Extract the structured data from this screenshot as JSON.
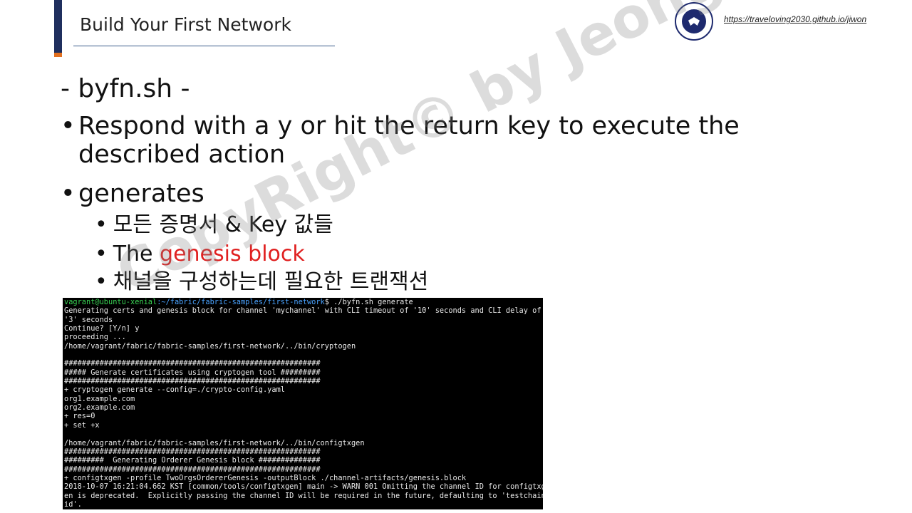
{
  "header": {
    "title": "Build Your First Network",
    "url": "https://traveloving2030.github.io/jiwon"
  },
  "content": {
    "heading": "- byfn.sh -",
    "bullet_1": "Respond with a y or hit the return key to execute the described action",
    "bullet_2": "generates",
    "sub_1": "모든 증명서 & Key 값들",
    "sub_2_prefix": "The ",
    "sub_2_highlight": "genesis block",
    "sub_3": "채널을 구성하는데 필요한 트랜잭션",
    "bullet_symbol": "•"
  },
  "terminal": {
    "prompt_user": "vagrant@ubuntu-xenial",
    "prompt_path": ":~/fabric/fabric-samples/first-network",
    "prompt_cmd": "$ ./byfn.sh generate",
    "lines": [
      "Generating certs and genesis block for channel 'mychannel' with CLI timeout of '10' seconds and CLI delay of",
      "'3' seconds",
      "Continue? [Y/n] y",
      "proceeding ...",
      "/home/vagrant/fabric/fabric-samples/first-network/../bin/cryptogen",
      "",
      "##########################################################",
      "##### Generate certificates using cryptogen tool #########",
      "##########################################################",
      "+ cryptogen generate --config=./crypto-config.yaml",
      "org1.example.com",
      "org2.example.com",
      "+ res=0",
      "+ set +x",
      "",
      "/home/vagrant/fabric/fabric-samples/first-network/../bin/configtxgen",
      "##########################################################",
      "#########  Generating Orderer Genesis block ##############",
      "##########################################################",
      "+ configtxgen -profile TwoOrgsOrdererGenesis -outputBlock ./channel-artifacts/genesis.block",
      "2018-10-07 16:21:04.662 KST [common/tools/configtxgen] main -> WARN 001 Omitting the channel ID for configtxg",
      "en is deprecated.  Explicitly passing the channel ID will be required in the future, defaulting to 'testchain",
      "id'."
    ]
  },
  "watermark": "CopyRight© by Jeong JiWon",
  "colors": {
    "accent_navy": "#1f2f5e",
    "accent_orange": "#e2701f",
    "highlight_red": "#e02020",
    "terminal_bg": "#000000"
  },
  "icons": {
    "logo": "university-seal-logo"
  }
}
